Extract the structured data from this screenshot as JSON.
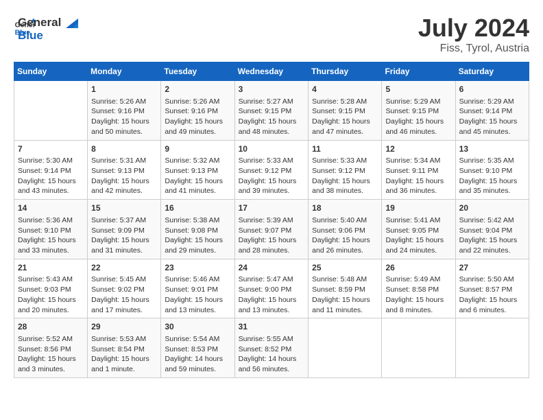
{
  "header": {
    "logo_line1": "General",
    "logo_line2": "Blue",
    "title": "July 2024",
    "subtitle": "Fiss, Tyrol, Austria"
  },
  "calendar": {
    "days_of_week": [
      "Sunday",
      "Monday",
      "Tuesday",
      "Wednesday",
      "Thursday",
      "Friday",
      "Saturday"
    ],
    "weeks": [
      [
        {
          "day": "",
          "content": ""
        },
        {
          "day": "1",
          "content": "Sunrise: 5:26 AM\nSunset: 9:16 PM\nDaylight: 15 hours\nand 50 minutes."
        },
        {
          "day": "2",
          "content": "Sunrise: 5:26 AM\nSunset: 9:16 PM\nDaylight: 15 hours\nand 49 minutes."
        },
        {
          "day": "3",
          "content": "Sunrise: 5:27 AM\nSunset: 9:15 PM\nDaylight: 15 hours\nand 48 minutes."
        },
        {
          "day": "4",
          "content": "Sunrise: 5:28 AM\nSunset: 9:15 PM\nDaylight: 15 hours\nand 47 minutes."
        },
        {
          "day": "5",
          "content": "Sunrise: 5:29 AM\nSunset: 9:15 PM\nDaylight: 15 hours\nand 46 minutes."
        },
        {
          "day": "6",
          "content": "Sunrise: 5:29 AM\nSunset: 9:14 PM\nDaylight: 15 hours\nand 45 minutes."
        }
      ],
      [
        {
          "day": "7",
          "content": "Sunrise: 5:30 AM\nSunset: 9:14 PM\nDaylight: 15 hours\nand 43 minutes."
        },
        {
          "day": "8",
          "content": "Sunrise: 5:31 AM\nSunset: 9:13 PM\nDaylight: 15 hours\nand 42 minutes."
        },
        {
          "day": "9",
          "content": "Sunrise: 5:32 AM\nSunset: 9:13 PM\nDaylight: 15 hours\nand 41 minutes."
        },
        {
          "day": "10",
          "content": "Sunrise: 5:33 AM\nSunset: 9:12 PM\nDaylight: 15 hours\nand 39 minutes."
        },
        {
          "day": "11",
          "content": "Sunrise: 5:33 AM\nSunset: 9:12 PM\nDaylight: 15 hours\nand 38 minutes."
        },
        {
          "day": "12",
          "content": "Sunrise: 5:34 AM\nSunset: 9:11 PM\nDaylight: 15 hours\nand 36 minutes."
        },
        {
          "day": "13",
          "content": "Sunrise: 5:35 AM\nSunset: 9:10 PM\nDaylight: 15 hours\nand 35 minutes."
        }
      ],
      [
        {
          "day": "14",
          "content": "Sunrise: 5:36 AM\nSunset: 9:10 PM\nDaylight: 15 hours\nand 33 minutes."
        },
        {
          "day": "15",
          "content": "Sunrise: 5:37 AM\nSunset: 9:09 PM\nDaylight: 15 hours\nand 31 minutes."
        },
        {
          "day": "16",
          "content": "Sunrise: 5:38 AM\nSunset: 9:08 PM\nDaylight: 15 hours\nand 29 minutes."
        },
        {
          "day": "17",
          "content": "Sunrise: 5:39 AM\nSunset: 9:07 PM\nDaylight: 15 hours\nand 28 minutes."
        },
        {
          "day": "18",
          "content": "Sunrise: 5:40 AM\nSunset: 9:06 PM\nDaylight: 15 hours\nand 26 minutes."
        },
        {
          "day": "19",
          "content": "Sunrise: 5:41 AM\nSunset: 9:05 PM\nDaylight: 15 hours\nand 24 minutes."
        },
        {
          "day": "20",
          "content": "Sunrise: 5:42 AM\nSunset: 9:04 PM\nDaylight: 15 hours\nand 22 minutes."
        }
      ],
      [
        {
          "day": "21",
          "content": "Sunrise: 5:43 AM\nSunset: 9:03 PM\nDaylight: 15 hours\nand 20 minutes."
        },
        {
          "day": "22",
          "content": "Sunrise: 5:45 AM\nSunset: 9:02 PM\nDaylight: 15 hours\nand 17 minutes."
        },
        {
          "day": "23",
          "content": "Sunrise: 5:46 AM\nSunset: 9:01 PM\nDaylight: 15 hours\nand 13 minutes."
        },
        {
          "day": "24",
          "content": "Sunrise: 5:47 AM\nSunset: 9:00 PM\nDaylight: 15 hours\nand 13 minutes."
        },
        {
          "day": "25",
          "content": "Sunrise: 5:48 AM\nSunset: 8:59 PM\nDaylight: 15 hours\nand 11 minutes."
        },
        {
          "day": "26",
          "content": "Sunrise: 5:49 AM\nSunset: 8:58 PM\nDaylight: 15 hours\nand 8 minutes."
        },
        {
          "day": "27",
          "content": "Sunrise: 5:50 AM\nSunset: 8:57 PM\nDaylight: 15 hours\nand 6 minutes."
        }
      ],
      [
        {
          "day": "28",
          "content": "Sunrise: 5:52 AM\nSunset: 8:56 PM\nDaylight: 15 hours\nand 3 minutes."
        },
        {
          "day": "29",
          "content": "Sunrise: 5:53 AM\nSunset: 8:54 PM\nDaylight: 15 hours\nand 1 minute."
        },
        {
          "day": "30",
          "content": "Sunrise: 5:54 AM\nSunset: 8:53 PM\nDaylight: 14 hours\nand 59 minutes."
        },
        {
          "day": "31",
          "content": "Sunrise: 5:55 AM\nSunset: 8:52 PM\nDaylight: 14 hours\nand 56 minutes."
        },
        {
          "day": "",
          "content": ""
        },
        {
          "day": "",
          "content": ""
        },
        {
          "day": "",
          "content": ""
        }
      ]
    ]
  }
}
